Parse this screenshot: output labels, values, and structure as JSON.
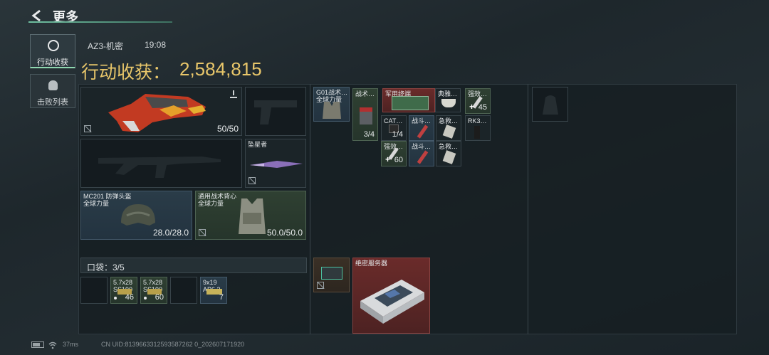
{
  "header": {
    "title": "更多"
  },
  "nav": [
    {
      "label": "行动收获",
      "active": true
    },
    {
      "label": "击败列表",
      "active": false
    }
  ],
  "info": {
    "map": "AZ3-机密",
    "time": "19:08"
  },
  "haul": {
    "label": "行动收获：",
    "value": "2,584,815"
  },
  "gear": {
    "primary_ammo": "50/50",
    "helmet": {
      "name": "MC201 防弹头盔",
      "sub": "全球力量",
      "durability": "28.0/28.0"
    },
    "vest": {
      "name": "通用战术背心",
      "sub": "全球力量",
      "durability": "50.0/50.0"
    },
    "melee": {
      "name": "坠星者"
    }
  },
  "pocket": {
    "label": "口袋：3/5",
    "items": [
      {
        "name": "5.7x28 SS190",
        "count": "46"
      },
      {
        "name": "5.7x28 SS190",
        "count": "60"
      },
      {
        "name": "9x19 AP6.3",
        "count": "7"
      }
    ]
  },
  "rig": {
    "name": "G01战术…",
    "sub": "全球力量"
  },
  "rig_items": [
    {
      "name": "战术…",
      "count": "3/4"
    },
    {
      "name": "军用终端",
      "count": ""
    },
    {
      "name": "典雅…",
      "count": ""
    },
    {
      "name": "强效…",
      "count": "45"
    },
    {
      "name": "CAT…",
      "count": "1/4"
    },
    {
      "name": "战斗…",
      "count": ""
    },
    {
      "name": "急救…",
      "count": ""
    },
    {
      "name": "RK3…",
      "count": ""
    },
    {
      "name": "强效…",
      "count": "60"
    },
    {
      "name": "战斗…",
      "count": ""
    },
    {
      "name": "急救…",
      "count": ""
    }
  ],
  "backpack": {
    "item": "绝密服务器"
  },
  "footer": {
    "ping": "37ms",
    "uid": "CN UID:8139663312593587262 0_202607171920"
  }
}
